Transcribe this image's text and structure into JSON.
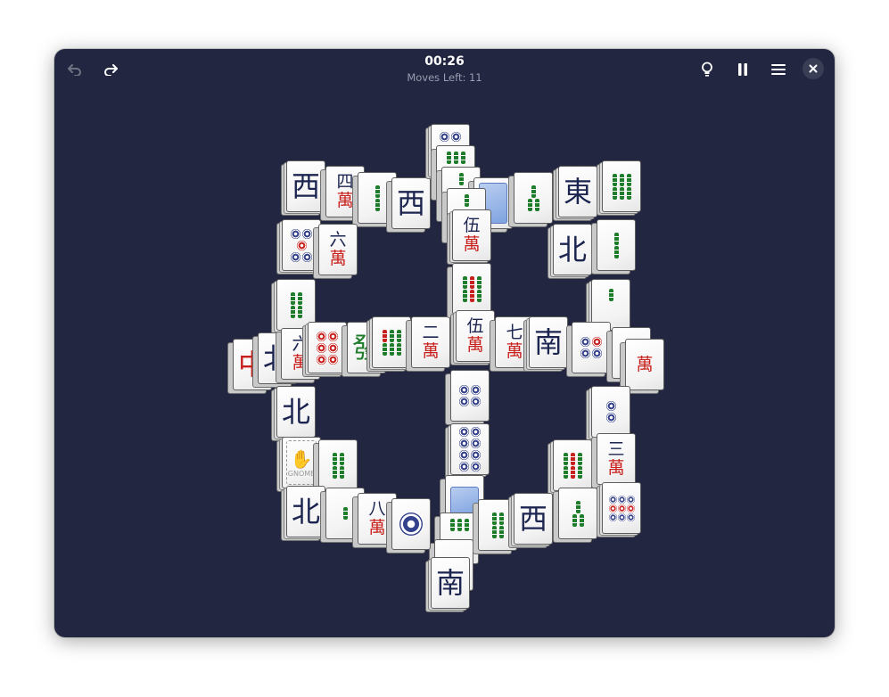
{
  "header": {
    "timer": "00:26",
    "moves_left": "Moves Left: 11",
    "undo_icon": "undo-arrow-icon",
    "redo_icon": "redo-arrow-icon",
    "hint_icon": "lightbulb-icon",
    "pause_icon": "pause-icon",
    "menu_icon": "hamburger-menu-icon",
    "close_icon": "close-icon"
  },
  "colors": {
    "background": "#222640",
    "tile_face": "#f3f3f3",
    "character_navy": "#1c2450",
    "character_red": "#c8201c",
    "bamboo_green": "#1e7d2a",
    "dot_blue": "#34418c"
  },
  "tiles": {
    "west": "西",
    "east": "東",
    "north": "北",
    "south": "南",
    "red_dragon": "中",
    "green_dragon": "發",
    "wan": "萬",
    "num_four": "四",
    "num_six": "六",
    "num_five": "伍",
    "num_two": "二",
    "num_seven": "七",
    "num_three": "三",
    "num_eight": "八",
    "gnome_label": "GNOME"
  }
}
